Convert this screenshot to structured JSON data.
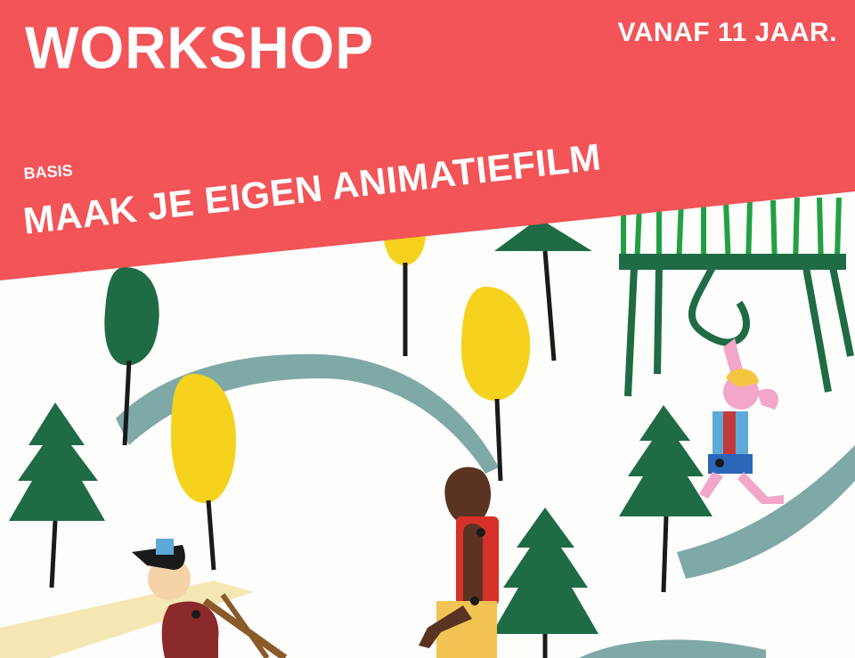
{
  "banner": {
    "title": "WORKSHOP",
    "age": "VANAF 11 JAAR.",
    "level": "BASIS",
    "headline": "MAAK JE EIGEN ANIMATIEFILM"
  },
  "colors": {
    "banner": "#f25457",
    "tree_green": "#1f6b45",
    "leaf_yellow": "#f4d21e",
    "path_teal": "#7fa9a7",
    "fence_green": "#22a043"
  }
}
